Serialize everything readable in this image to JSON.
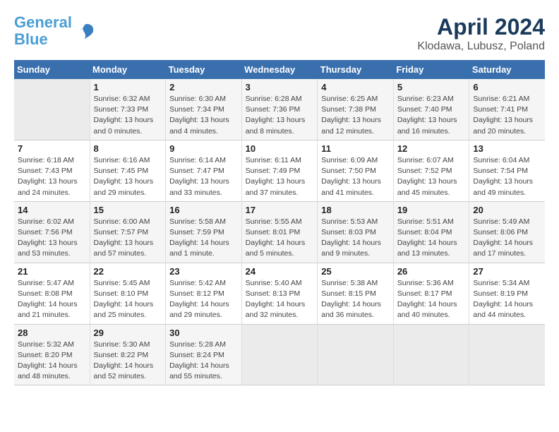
{
  "header": {
    "logo_line1": "General",
    "logo_line2": "Blue",
    "title": "April 2024",
    "subtitle": "Klodawa, Lubusz, Poland"
  },
  "calendar": {
    "days_of_week": [
      "Sunday",
      "Monday",
      "Tuesday",
      "Wednesday",
      "Thursday",
      "Friday",
      "Saturday"
    ],
    "weeks": [
      [
        {
          "day": "",
          "info": ""
        },
        {
          "day": "1",
          "info": "Sunrise: 6:32 AM\nSunset: 7:33 PM\nDaylight: 13 hours\nand 0 minutes."
        },
        {
          "day": "2",
          "info": "Sunrise: 6:30 AM\nSunset: 7:34 PM\nDaylight: 13 hours\nand 4 minutes."
        },
        {
          "day": "3",
          "info": "Sunrise: 6:28 AM\nSunset: 7:36 PM\nDaylight: 13 hours\nand 8 minutes."
        },
        {
          "day": "4",
          "info": "Sunrise: 6:25 AM\nSunset: 7:38 PM\nDaylight: 13 hours\nand 12 minutes."
        },
        {
          "day": "5",
          "info": "Sunrise: 6:23 AM\nSunset: 7:40 PM\nDaylight: 13 hours\nand 16 minutes."
        },
        {
          "day": "6",
          "info": "Sunrise: 6:21 AM\nSunset: 7:41 PM\nDaylight: 13 hours\nand 20 minutes."
        }
      ],
      [
        {
          "day": "7",
          "info": "Sunrise: 6:18 AM\nSunset: 7:43 PM\nDaylight: 13 hours\nand 24 minutes."
        },
        {
          "day": "8",
          "info": "Sunrise: 6:16 AM\nSunset: 7:45 PM\nDaylight: 13 hours\nand 29 minutes."
        },
        {
          "day": "9",
          "info": "Sunrise: 6:14 AM\nSunset: 7:47 PM\nDaylight: 13 hours\nand 33 minutes."
        },
        {
          "day": "10",
          "info": "Sunrise: 6:11 AM\nSunset: 7:49 PM\nDaylight: 13 hours\nand 37 minutes."
        },
        {
          "day": "11",
          "info": "Sunrise: 6:09 AM\nSunset: 7:50 PM\nDaylight: 13 hours\nand 41 minutes."
        },
        {
          "day": "12",
          "info": "Sunrise: 6:07 AM\nSunset: 7:52 PM\nDaylight: 13 hours\nand 45 minutes."
        },
        {
          "day": "13",
          "info": "Sunrise: 6:04 AM\nSunset: 7:54 PM\nDaylight: 13 hours\nand 49 minutes."
        }
      ],
      [
        {
          "day": "14",
          "info": "Sunrise: 6:02 AM\nSunset: 7:56 PM\nDaylight: 13 hours\nand 53 minutes."
        },
        {
          "day": "15",
          "info": "Sunrise: 6:00 AM\nSunset: 7:57 PM\nDaylight: 13 hours\nand 57 minutes."
        },
        {
          "day": "16",
          "info": "Sunrise: 5:58 AM\nSunset: 7:59 PM\nDaylight: 14 hours\nand 1 minute."
        },
        {
          "day": "17",
          "info": "Sunrise: 5:55 AM\nSunset: 8:01 PM\nDaylight: 14 hours\nand 5 minutes."
        },
        {
          "day": "18",
          "info": "Sunrise: 5:53 AM\nSunset: 8:03 PM\nDaylight: 14 hours\nand 9 minutes."
        },
        {
          "day": "19",
          "info": "Sunrise: 5:51 AM\nSunset: 8:04 PM\nDaylight: 14 hours\nand 13 minutes."
        },
        {
          "day": "20",
          "info": "Sunrise: 5:49 AM\nSunset: 8:06 PM\nDaylight: 14 hours\nand 17 minutes."
        }
      ],
      [
        {
          "day": "21",
          "info": "Sunrise: 5:47 AM\nSunset: 8:08 PM\nDaylight: 14 hours\nand 21 minutes."
        },
        {
          "day": "22",
          "info": "Sunrise: 5:45 AM\nSunset: 8:10 PM\nDaylight: 14 hours\nand 25 minutes."
        },
        {
          "day": "23",
          "info": "Sunrise: 5:42 AM\nSunset: 8:12 PM\nDaylight: 14 hours\nand 29 minutes."
        },
        {
          "day": "24",
          "info": "Sunrise: 5:40 AM\nSunset: 8:13 PM\nDaylight: 14 hours\nand 32 minutes."
        },
        {
          "day": "25",
          "info": "Sunrise: 5:38 AM\nSunset: 8:15 PM\nDaylight: 14 hours\nand 36 minutes."
        },
        {
          "day": "26",
          "info": "Sunrise: 5:36 AM\nSunset: 8:17 PM\nDaylight: 14 hours\nand 40 minutes."
        },
        {
          "day": "27",
          "info": "Sunrise: 5:34 AM\nSunset: 8:19 PM\nDaylight: 14 hours\nand 44 minutes."
        }
      ],
      [
        {
          "day": "28",
          "info": "Sunrise: 5:32 AM\nSunset: 8:20 PM\nDaylight: 14 hours\nand 48 minutes."
        },
        {
          "day": "29",
          "info": "Sunrise: 5:30 AM\nSunset: 8:22 PM\nDaylight: 14 hours\nand 52 minutes."
        },
        {
          "day": "30",
          "info": "Sunrise: 5:28 AM\nSunset: 8:24 PM\nDaylight: 14 hours\nand 55 minutes."
        },
        {
          "day": "",
          "info": ""
        },
        {
          "day": "",
          "info": ""
        },
        {
          "day": "",
          "info": ""
        },
        {
          "day": "",
          "info": ""
        }
      ]
    ]
  }
}
